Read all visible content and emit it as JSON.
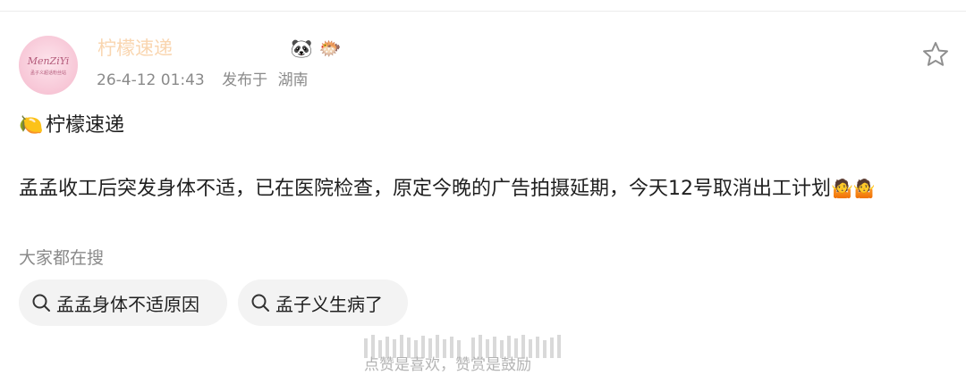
{
  "post": {
    "username": "柠檬速递",
    "timestamp": "26-4-12 01:43",
    "location_prefix": "发布于",
    "location": "湖南",
    "topic_emoji": "🍋",
    "topic": "柠檬速递",
    "content": "孟孟收工后突发身体不适，已在医院检查，原定今晚的广告拍摄延期，今天12号取消出工计划",
    "content_emojis": "🤷🤷"
  },
  "avatar": {
    "script_text": "MenZiYi",
    "sub_text": "孟子义超话粉丝站"
  },
  "badges": [
    "panda-icon",
    "pufferfish-icon"
  ],
  "search": {
    "label": "大家都在搜",
    "chips": [
      "孟孟身体不适原因",
      "孟子义生病了"
    ]
  },
  "footer": {
    "text": "点赞是喜欢，赞赏是鼓励"
  },
  "colors": {
    "username": "#f08a1c",
    "meta": "#8a8a8a",
    "chip_bg": "#f3f3f3"
  }
}
